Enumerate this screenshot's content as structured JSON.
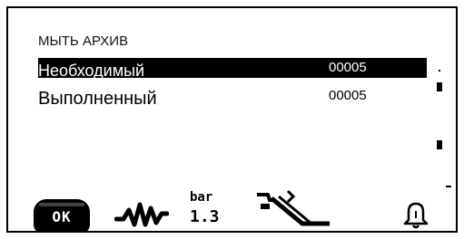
{
  "screen": {
    "title": "МЫТЬ АРХИВ",
    "rows": [
      {
        "label": "Необходимый",
        "value": "00005",
        "selected": true
      },
      {
        "label": "Выполненный",
        "value": "00005",
        "selected": false
      }
    ]
  },
  "softkeys": {
    "ok_label": "OK",
    "pressure_unit": "bar",
    "pressure_value": "1.3",
    "icons": [
      "ok-button",
      "waveform-icon",
      "pressure-icon",
      "tools-icon",
      "alarm-bell-icon"
    ]
  }
}
